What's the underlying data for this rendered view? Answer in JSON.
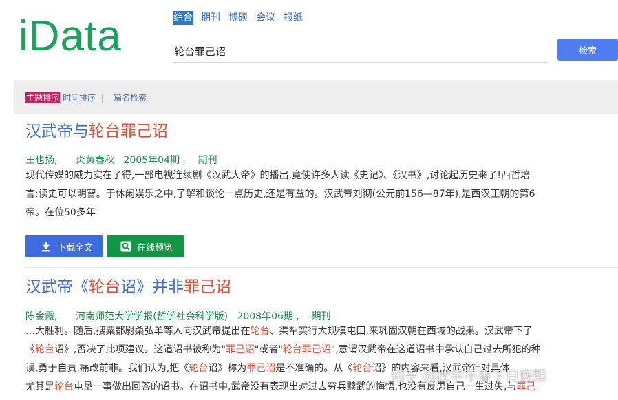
{
  "logo": {
    "text": "iData"
  },
  "nav": {
    "items": [
      "综合",
      "期刊",
      "博硕",
      "会议",
      "报纸"
    ],
    "active_index": 0
  },
  "search": {
    "value": "轮台罪己诏",
    "button_label": "检索"
  },
  "filters": {
    "sort_topic": "主题排序",
    "sort_time": "时间排序",
    "separator": "|",
    "title_search": "篇名检索"
  },
  "results": [
    {
      "title_parts": [
        "汉武帝与",
        "轮台罪己诏"
      ],
      "author": "王也扬,",
      "journal": "炎黄春秋",
      "date": "2005年04期 ,",
      "type": "期刊",
      "abstract_lines": [
        "现代传媒的威力实在了得,一部电视连续剧《汉武大帝》的播出,竟使许多人读《史记》、《汉书》,讨论起历史来了!西哲培",
        "言:读史可以明智。于休闲娱乐之中,了解和谈论一点历史,还是有益的。汉武帝刘彻(公元前156—87年),是西汉王朝的第6",
        "帝。在位50多年"
      ],
      "download_label": "下载全文",
      "preview_label": "在线预览"
    },
    {
      "title_parts": [
        "汉武帝《",
        "轮台",
        "诏》并非",
        "罪己诏"
      ],
      "author": "陈金霞,",
      "journal": "河南师范大学学报(哲学社会科学版)",
      "date": "2008年06期 ,",
      "type": "期刊",
      "abstract_lines": [
        [
          "…大胜利。随后,搜粟都尉桑弘羊等人向汉武帝提出在",
          "轮台",
          "、渠犁实行大规模屯田,来巩固汉朝在西域的战果。汉武帝下了"
        ],
        [
          "《",
          "轮台",
          "诏》,否决了此项建议。这道诏书被称为\"",
          "罪己诏",
          "\"或者\"",
          "轮台罪己诏",
          "\",意谓汉武帝在这道诏书中承认自己过去所犯的种"
        ],
        [
          "误,勇于自责,痛改前非。我们认为,把《",
          "轮台",
          "诏》称为",
          "罪己诏",
          "是不准确的。从《",
          "轮台",
          "诏》的内容来看,汉武帝针对具体"
        ],
        [
          "尤其是",
          "轮台",
          "屯垦一事做出回答的诏书。在诏书中,武帝没有表现出对过去穷兵黩武的悔悟,也没有反思自己一生过失,与",
          "罪己"
        ]
      ]
    }
  ],
  "watermark": "知乎 @枕字不香下日恢熙"
}
